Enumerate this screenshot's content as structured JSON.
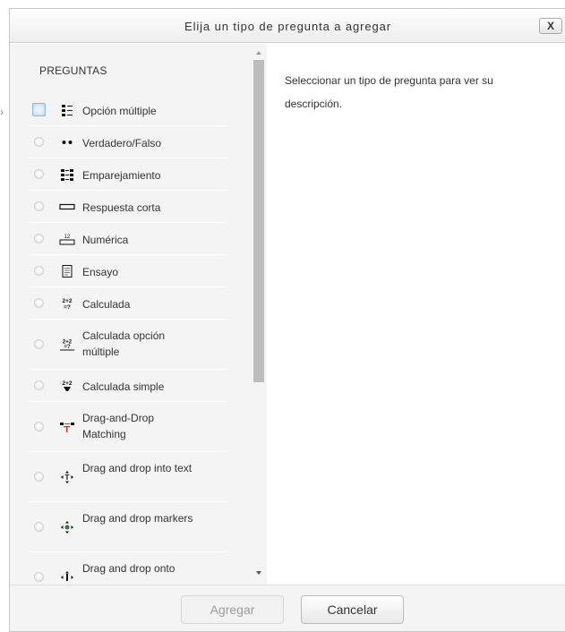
{
  "dialog": {
    "title": "Elija un tipo de pregunta a agregar",
    "close_label": "X"
  },
  "left_panel": {
    "section_title": "PREGUNTAS",
    "items": [
      {
        "label": "Opción múltiple",
        "icon": "multichoice-icon",
        "selected_focus": true
      },
      {
        "label": "Verdadero/Falso",
        "icon": "truefalse-icon"
      },
      {
        "label": "Emparejamiento",
        "icon": "match-icon"
      },
      {
        "label": "Respuesta corta",
        "icon": "shortanswer-icon"
      },
      {
        "label": "Numérica",
        "icon": "numerical-icon"
      },
      {
        "label": "Ensayo",
        "icon": "essay-icon"
      },
      {
        "label": "Calculada",
        "icon": "calculated-icon"
      },
      {
        "label": "Calculada opción múltiple",
        "icon": "calculatedmulti-icon"
      },
      {
        "label": "Calculada simple",
        "icon": "calculatedsimple-icon"
      },
      {
        "label": "Drag-and-Drop Matching",
        "icon": "ddmatch-icon"
      },
      {
        "label": "Drag and drop into text",
        "icon": "ddwtos-icon"
      },
      {
        "label": "Drag and drop markers",
        "icon": "ddmarker-icon"
      },
      {
        "label": "Drag and drop onto",
        "icon": "ddimageortext-icon"
      }
    ]
  },
  "right_panel": {
    "description": "Seleccionar un tipo de pregunta para ver su descripción."
  },
  "footer": {
    "add_label": "Agregar",
    "cancel_label": "Cancelar"
  },
  "colors": {
    "panel_bg": "#f4f4f4",
    "text": "#333333",
    "disabled_text": "#9a9a9a"
  }
}
